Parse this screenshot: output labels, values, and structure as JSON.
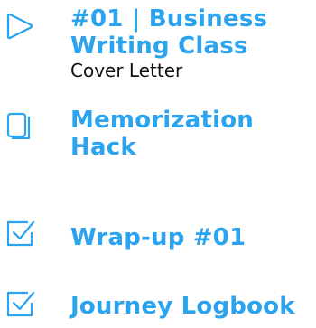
{
  "accent_color": "#2ba3ee",
  "items": [
    {
      "icon": "play-outline-icon",
      "title": "#01 | Business Writing Class",
      "subtitle": "Cover Letter"
    },
    {
      "icon": "stacked-pages-icon",
      "title": "Memorization Hack"
    },
    {
      "icon": "checkbox-icon",
      "title": "Wrap-up #01"
    },
    {
      "icon": "checkbox-icon",
      "title": "Journey Logbook"
    }
  ]
}
